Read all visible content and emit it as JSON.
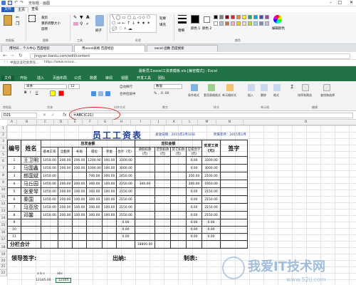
{
  "paint": {
    "title": "无标题 - 画图",
    "tabs": [
      "文件",
      "主页",
      "查看"
    ],
    "groups": [
      "剪贴板",
      "图像",
      "工具",
      "形状",
      "颜色"
    ],
    "ribbon_labels": [
      "裁剪",
      "重新调整大小",
      "旋转",
      "刷子",
      "轮廓",
      "填充",
      "粗细",
      "颜色 1",
      "颜色 2",
      "编辑颜色"
    ],
    "palette": [
      "#000000",
      "#7f7f7f",
      "#880015",
      "#ed1c24",
      "#ff7f27",
      "#fff200",
      "#22b14c",
      "#00a2e8",
      "#3f48cc",
      "#a349a4",
      "#ffffff",
      "#c3c3c3",
      "#b97a57",
      "#ffaec9",
      "#ffc90e",
      "#efe4b0",
      "#b5e61d",
      "#99d9ea",
      "#7092be",
      "#c8bfe7"
    ]
  },
  "browser": {
    "tabs": [
      "用时间... 个人中心 百度经验",
      "用excel表格 百度经验",
      "excel 函数 百度搜索"
    ],
    "url": "jingyan.baidu.com/edit/content",
    "bookmarks": [
      "中国企业社会责任...",
      "https://www.ecova..."
    ]
  },
  "excel": {
    "title": "最新员工excel工资表模板.xls [兼容模式] - Excel",
    "tabs": [
      "文件",
      "开始",
      "插入",
      "页面布局",
      "公式",
      "数据",
      "审阅",
      "视图",
      "开发工具",
      "团队"
    ],
    "font_name": "宋体",
    "font_size": "12",
    "number_format": "数值",
    "ribbon_labels": [
      "自动换行",
      "合并后居中",
      "条件格式",
      "套用表格格式",
      "单元格样式",
      "插入",
      "删除",
      "格式",
      "排序和筛选",
      "查找和选择"
    ],
    "ribbon_groups": [
      "剪贴板",
      "字体",
      "对齐方式",
      "数字",
      "样式",
      "单元格",
      "编辑"
    ],
    "name_box": "D21",
    "formula": "=ABC(C21)",
    "columns": [
      "A",
      "B",
      "C",
      "D",
      "E",
      "F",
      "G",
      "H",
      "I",
      "J",
      "K",
      "L",
      "M",
      "N",
      "O"
    ],
    "rows": [
      "1",
      "2",
      "3",
      "4",
      "5",
      "6",
      "7",
      "8",
      "9",
      "10",
      "11",
      "12",
      "13",
      "14",
      "15",
      "16",
      "17",
      "18",
      "19",
      "20",
      "21",
      "22"
    ],
    "sheet_title": "员工工资表",
    "meta_left": "发放日期：2015年2月12日",
    "meta_right": "所属年月：2015年1月",
    "header": {
      "seq": "编号",
      "name": "姓名",
      "payable_group": "应发金额",
      "deduct_group": "应扣金额",
      "payable_cols": [
        "基本工资",
        "全勤奖",
        "补助",
        "岗位",
        "奖金",
        "合计（元）"
      ],
      "deduct_cols": [
        "请假扣款(元)",
        "迟到扣款(元)",
        "其它扣款(元)",
        "应扣合计(元)"
      ],
      "net": "实发工资(元)",
      "sign": "签字"
    },
    "employees": [
      {
        "no": "1",
        "name": "王卫明",
        "v": [
          "1450.00",
          "200.00",
          "200.00",
          "1200.00",
          "300.00",
          "3300.00",
          "",
          "",
          "",
          "0.00",
          "3300.00"
        ]
      },
      {
        "no": "2",
        "name": "马国鑫",
        "v": [
          "1450.00",
          "200.00",
          "200.00",
          "1000.00",
          "100.00",
          "3000.00",
          "",
          "",
          "",
          "0.00",
          "3000.00"
        ]
      },
      {
        "no": "3",
        "name": "郎国斌",
        "v": [
          "1450.00",
          "",
          "",
          "700.00",
          "300.00",
          "2450.00",
          "",
          "",
          "",
          "350.00",
          "2100.00"
        ]
      },
      {
        "no": "4",
        "name": "马丘园",
        "v": [
          "1450.00",
          "200.00",
          "200.00",
          "300.00",
          "100.00",
          "2250.00",
          "300.00",
          "",
          "",
          "300.00",
          "1950.00"
        ]
      },
      {
        "no": "5",
        "name": "张爱琴",
        "v": [
          "1450.00",
          "200.00",
          "100.00",
          "300.00",
          "100.00",
          "2150.00",
          "",
          "",
          "",
          "0.00",
          "2150.00"
        ]
      },
      {
        "no": "6",
        "name": "秦国",
        "v": [
          "1450.00",
          "200.00",
          "100.00",
          "300.00",
          "100.00",
          "2150.00",
          "",
          "",
          "",
          "0.00",
          "2150.00"
        ]
      },
      {
        "no": "7",
        "name": "马亚欣",
        "v": [
          "1450.00",
          "200.00",
          "100.00",
          "300.00",
          "100.00",
          "2150.00",
          "",
          "",
          "",
          "0.00",
          "2150.00"
        ]
      },
      {
        "no": "8",
        "name": "邓馨",
        "v": [
          "1450.00",
          "200.00",
          "100.00",
          "300.00",
          "100.00",
          "2150.00",
          "",
          "",
          "",
          "0.00",
          "2150.00"
        ]
      },
      {
        "no": "9",
        "name": "",
        "v": [
          "",
          "",
          "",
          "",
          "",
          "0.00",
          "",
          "",
          "",
          "0.00",
          "0.00"
        ]
      },
      {
        "no": "10",
        "name": "",
        "v": [
          "",
          "",
          "",
          "",
          "",
          "0.00",
          "",
          "",
          "",
          "0.00",
          "0.00"
        ]
      },
      {
        "no": "11",
        "name": "",
        "v": [
          "",
          "",
          "",
          "",
          "",
          "0.00",
          "",
          "",
          "",
          "0.00",
          "0.00"
        ]
      }
    ],
    "total_label": "分栏合计",
    "total_value": "18800.00",
    "leader_sign": "领导签字:",
    "cashier": "出纳:",
    "maker": "制表:",
    "small_text_1": "a b c",
    "small_text_2": "12345.00",
    "small_text_3": "abc",
    "small_text_4": "12345"
  },
  "watermark": {
    "main": "我爱IT技术网",
    "sub": "www.52ij.com"
  }
}
